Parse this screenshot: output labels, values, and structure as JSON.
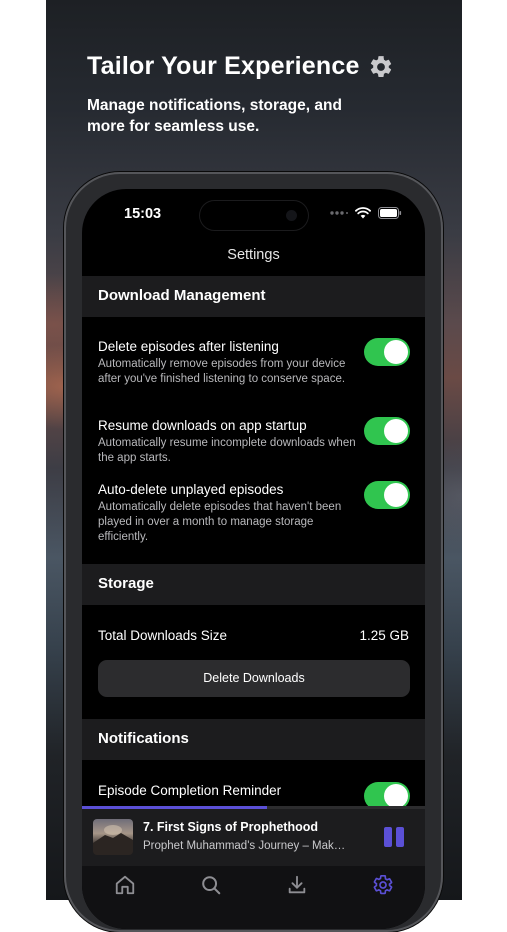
{
  "hero": {
    "title": "Tailor Your Experience",
    "title_icon": "gear-icon",
    "subtitle": "Manage notifications, storage, and more for seamless use."
  },
  "status_bar": {
    "time": "15:03",
    "icons": [
      "signal-dots-icon",
      "wifi-icon",
      "battery-icon"
    ]
  },
  "nav": {
    "title": "Settings"
  },
  "sections": {
    "download_management": {
      "title": "Download Management",
      "items": [
        {
          "title": "Delete episodes after listening",
          "description": "Automatically remove episodes from your device after you've finished listening to conserve space.",
          "enabled": true
        },
        {
          "title": "Resume downloads on app startup",
          "description": "Automatically resume incomplete downloads when the app starts.",
          "enabled": true
        },
        {
          "title": "Auto-delete unplayed episodes",
          "description": "Automatically delete episodes that haven't been played in over a month to manage storage efficiently.",
          "enabled": true
        }
      ]
    },
    "storage": {
      "title": "Storage",
      "total_label": "Total Downloads Size",
      "total_value": "1.25 GB",
      "delete_button": "Delete Downloads"
    },
    "notifications": {
      "title": "Notifications",
      "items": [
        {
          "title": "Episode Completion Reminder",
          "enabled": true
        }
      ]
    }
  },
  "mini_player": {
    "title": "7. First Signs of Prophethood",
    "subtitle": "Prophet Muhammad's Journey – Mak…",
    "progress": 0.54,
    "state_icon": "pause-icon"
  },
  "tab_bar": {
    "tabs": [
      {
        "icon": "home-icon",
        "active": false
      },
      {
        "icon": "search-icon",
        "active": false
      },
      {
        "icon": "download-icon",
        "active": false
      },
      {
        "icon": "gear-icon",
        "active": true
      }
    ]
  },
  "colors": {
    "accent": "#5b50d6",
    "toggle_on": "#30c54f",
    "section_bg": "#1c1c1e",
    "screen_bg": "#000000"
  }
}
